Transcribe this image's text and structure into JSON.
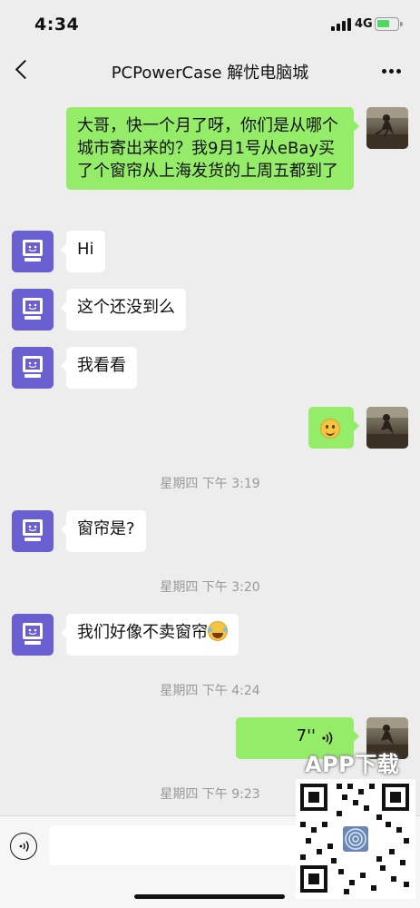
{
  "status_bar": {
    "time": "4:34",
    "network": "4G"
  },
  "nav": {
    "title": "PCPowerCase 解忧电脑城"
  },
  "messages": [
    {
      "side": "right",
      "text": "大哥，快一个月了呀，你们是从哪个城市寄出来的？我9月1号从eBay买了个窗帘从上海发货的上周五都到了"
    },
    {
      "side": "left",
      "text": "Hi"
    },
    {
      "side": "left",
      "text": "这个还没到么"
    },
    {
      "side": "left",
      "text": "我看看"
    },
    {
      "side": "right",
      "emoji": "smile-emoji"
    },
    {
      "timestamp": "星期四 下午 3:19"
    },
    {
      "side": "left",
      "text": "窗帘是?"
    },
    {
      "timestamp": "星期四 下午 3:20"
    },
    {
      "side": "left",
      "text": "我们好像不卖窗帘",
      "emoji": "laugh-emoji"
    },
    {
      "timestamp": "星期四 下午 4:24"
    },
    {
      "side": "right",
      "voice_duration": "7''"
    },
    {
      "timestamp": "星期四 下午 9:23"
    }
  ],
  "watermark": {
    "label": "APP下载"
  },
  "colors": {
    "background": "#ededed",
    "bubble_right": "#95ec69",
    "bubble_left": "#ffffff",
    "bot_avatar": "#6a5fd0"
  }
}
